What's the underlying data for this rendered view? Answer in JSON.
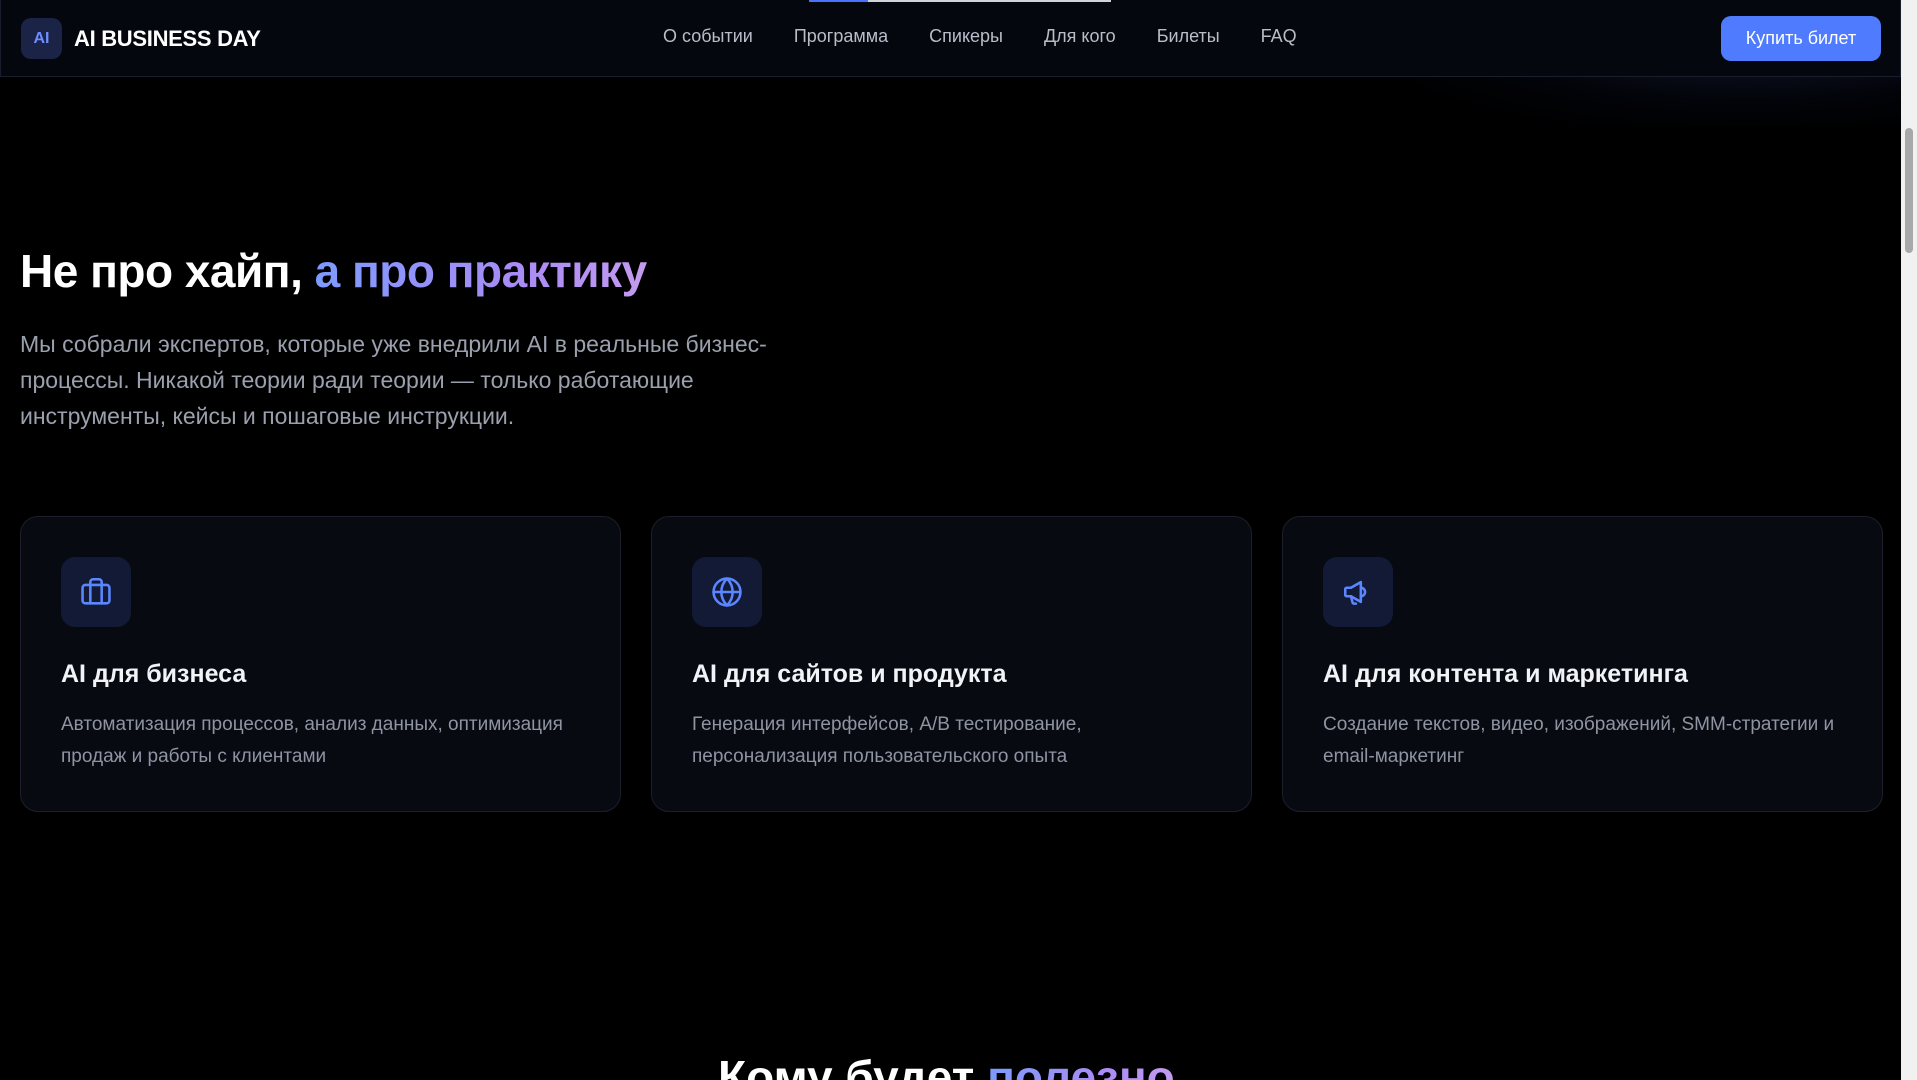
{
  "header": {
    "logo_mark": "AI",
    "brand_name": "AI BUSINESS DAY",
    "nav": [
      {
        "label": "О событии"
      },
      {
        "label": "Программа"
      },
      {
        "label": "Спикеры"
      },
      {
        "label": "Для кого"
      },
      {
        "label": "Билеты"
      },
      {
        "label": "FAQ"
      }
    ],
    "cta_label": "Купить билет",
    "scroll_progress": 0.196
  },
  "hero": {
    "title_plain": "Не про хайп, ",
    "title_accent": "а про практику",
    "description": "Мы собрали экспертов, которые уже внедрили AI в реальные бизнес-процессы. Никакой теории ради теории — только работающие инструменты, кейсы и пошаговые инструкции."
  },
  "cards": [
    {
      "icon": "briefcase-icon",
      "title": "AI для бизнеса",
      "text": "Автоматизация процессов, анализ данных, оптимизация продаж и работы с клиентами"
    },
    {
      "icon": "globe-icon",
      "title": "AI для сайтов и продукта",
      "text": "Генерация интерфейсов, A/B тестирование, персонализация пользовательского опыта"
    },
    {
      "icon": "megaphone-icon",
      "title": "AI для контента и маркетинга",
      "text": "Создание текстов, видео, изображений, SMM-стратегии и email-маркетинг"
    }
  ],
  "next_section": {
    "title_plain": "Кому будет ",
    "title_accent": "полезно"
  },
  "colors": {
    "background": "#000000",
    "accent": "#4f7bff",
    "card_background": "#080a12",
    "icon_color": "#5b86ff"
  }
}
